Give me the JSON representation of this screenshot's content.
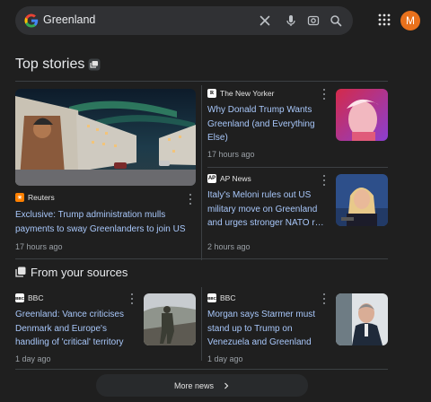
{
  "search": {
    "query": "Greenland"
  },
  "account": {
    "avatar_letter": "M"
  },
  "top_stories": {
    "title": "Top stories",
    "stories": [
      {
        "source": "Reuters",
        "headline": "Exclusive: Trump administration mulls payments to sway Greenlanders to join US",
        "time": "17 hours ago",
        "image": "greenland-town-mural-northern-lights"
      },
      {
        "source": "The New Yorker",
        "headline": "Why Donald Trump Wants Greenland (and Everything Else)",
        "time": "17 hours ago",
        "image": "trump-portrait"
      },
      {
        "source": "AP News",
        "headline": "Italy's Meloni rules out US military move on Greenland and urges stronger NATO r…",
        "time": "2 hours ago",
        "image": "meloni-speaking"
      }
    ]
  },
  "from_your_sources": {
    "title": "From your sources",
    "stories": [
      {
        "source": "BBC",
        "headline": "Greenland: Vance criticises Denmark and Europe's handling of 'critical' territory",
        "time": "1 day ago",
        "image": "soldier-snow"
      },
      {
        "source": "BBC",
        "headline": "Morgan says Starmer must stand up to Trump on Venezuela and Greenland",
        "time": "1 day ago",
        "image": "starmer-outdoors"
      }
    ]
  },
  "more_news": {
    "label": "More news"
  },
  "colors": {
    "background": "#1f1f1f",
    "link": "#a8c7fa",
    "muted": "#9aa0a6",
    "avatar": "#e8711c"
  }
}
